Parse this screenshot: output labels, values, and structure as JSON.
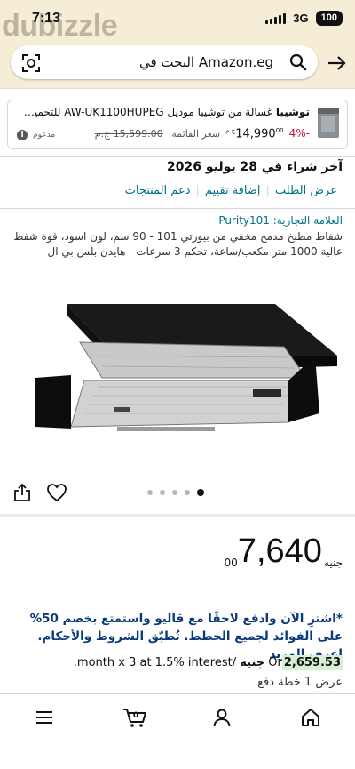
{
  "status_bar": {
    "time": "7:13",
    "watermark": "dubizzle",
    "network": "3G",
    "battery": "100"
  },
  "search": {
    "query": "Amazon.eg البحث في"
  },
  "ad": {
    "title_brand": "توشيبا",
    "title_rest": "غسالة من توشيبا موديل AW-UK1100HUPEG للتحميل العلوي...",
    "discount": "-4%",
    "price": "14,990",
    "price_decimals": "00",
    "price_currency": "ج.م",
    "list_label": "سعر القائمة:",
    "list_price": "15,599.00 ج.م",
    "sponsored": "مدعوم",
    "info": "i"
  },
  "order_info": {
    "last_bought": "آخر شراء في 28 يوليو 2026",
    "links": [
      "عرض الطلب",
      "إضافة تقييم",
      "دعم المنتجات"
    ]
  },
  "product": {
    "brand_link": "العلامة التجارية: Purity101",
    "title": "شفاط مطبخ مدمج مخفي من بيورتي 101 - 90 سم، لون اسود، قوة شفط عالية 1000 متر مكعب/ساعة، تحكم 3 سرعات - هايدن بلس بي ال",
    "image_count": 5,
    "active_image": 5
  },
  "price": {
    "currency": "جنيه",
    "whole": "7,640",
    "decimals": "00"
  },
  "promo": {
    "text": "*اشترِ الآن وادفع لاحقًا مع ڤاليو واستمتع بخصم 50% على الفوائد لجميع الخطط. تُطبّق الشروط والأحكام. اعرف المزيد"
  },
  "installment": {
    "prefix": "Or",
    "amount": "2,659.53",
    "currency": "جنيه",
    "suffix": "/month x 3 at 1.5% interest."
  },
  "plan_link": "عرض 1 خطة دفع",
  "bottom_nav": [
    "home-icon",
    "account-icon",
    "cart-icon",
    "menu-icon"
  ],
  "cart_count": "0",
  "colors": {
    "header_bg": "#f6edd6",
    "link": "#007185",
    "promo": "#0a3a7a",
    "discount": "#cc0c39",
    "installment_highlight": "#d7f0d4"
  }
}
